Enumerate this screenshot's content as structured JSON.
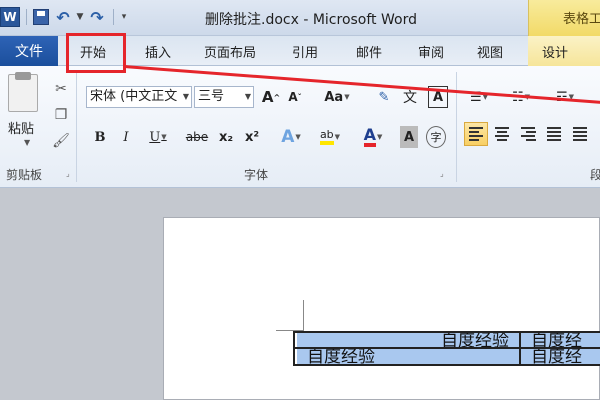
{
  "titlebar": {
    "title": "删除批注.docx - Microsoft Word",
    "word_logo": "W",
    "context_tab_group": "表格工",
    "accent": "#2b579a"
  },
  "tabs": {
    "file": "文件",
    "items": [
      "开始",
      "插入",
      "页面布局",
      "引用",
      "邮件",
      "审阅",
      "视图",
      "设计"
    ]
  },
  "ribbon": {
    "clipboard": {
      "paste": "粘贴",
      "group_label": "剪贴板"
    },
    "font": {
      "font_name": "宋体 (中文正文",
      "font_size": "三号",
      "group_label": "字体",
      "grow_font": "A",
      "shrink_font": "A",
      "change_case": "Aa",
      "phonetic": "文",
      "char_border": "A",
      "bold": "B",
      "italic": "I",
      "underline": "U",
      "strike": "abe",
      "subscript": "x₂",
      "superscript": "x²",
      "text_effects": "A",
      "highlight": "ab",
      "font_color": "A",
      "char_shading": "A",
      "enclose": "字"
    },
    "paragraph": {
      "group_label": "段"
    }
  },
  "document": {
    "row1_right": "自度经验",
    "row1_far": "自度经",
    "row2_left": "自度经验",
    "row2_right": "自度经"
  },
  "colors": {
    "highlight_annotation": "#e5252b",
    "selection": "#a9c8ef",
    "context_tab": "#f2da68"
  }
}
